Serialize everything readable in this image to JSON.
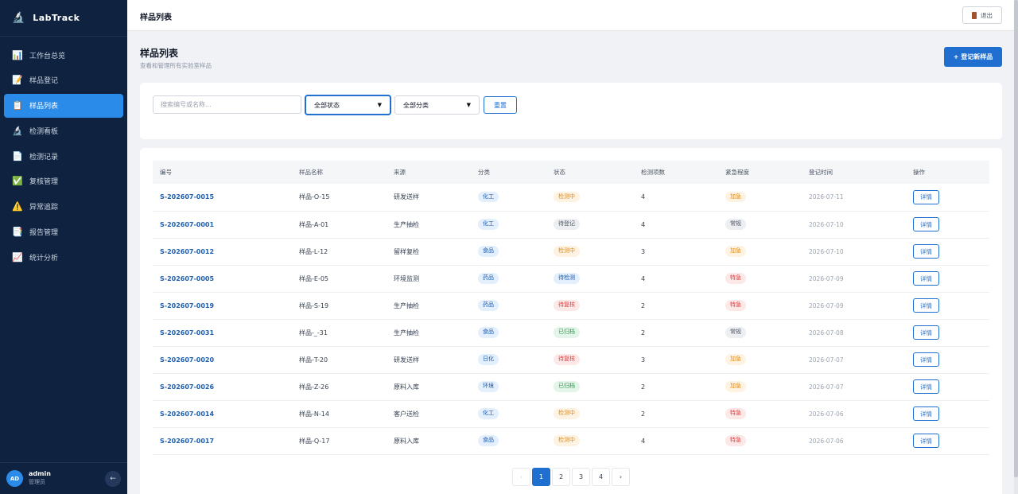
{
  "brand": {
    "logo": "🔬",
    "name": "LabTrack"
  },
  "sidebar": {
    "items": [
      {
        "icon": "📊",
        "label": "工作台总览"
      },
      {
        "icon": "📝",
        "label": "样品登记"
      },
      {
        "icon": "📋",
        "label": "样品列表",
        "active": true
      },
      {
        "icon": "🔬",
        "label": "检测看板"
      },
      {
        "icon": "📄",
        "label": "检测记录"
      },
      {
        "icon": "✅",
        "label": "复核管理"
      },
      {
        "icon": "⚠️",
        "label": "异常追踪"
      },
      {
        "icon": "📑",
        "label": "报告管理"
      },
      {
        "icon": "📈",
        "label": "统计分析"
      }
    ]
  },
  "user": {
    "initials": "AD",
    "name": "admin",
    "role": "管理员",
    "collapse_icon": "←"
  },
  "topbar": {
    "title": "样品列表",
    "logout_label": "退出"
  },
  "page": {
    "title": "样品列表",
    "subtitle": "查看和管理所有实验室样品",
    "add_button": "+ 登记新样品"
  },
  "filters": {
    "search_placeholder": "搜索编号或名称...",
    "status": "全部状态",
    "category": "全部分类",
    "reset": "重置"
  },
  "table": {
    "headers": [
      "编号",
      "样品名称",
      "来源",
      "分类",
      "状态",
      "检测项数",
      "紧急程度",
      "登记时间",
      "操作"
    ],
    "rows": [
      {
        "code": "S-202607-0015",
        "name": "样品-O-15",
        "source": "研发送样",
        "category": "化工",
        "status": "检测中",
        "status_color": "orange",
        "items": "4",
        "urgency": "加急",
        "urgency_color": "orange",
        "date": "2026-07-11",
        "action": "详情"
      },
      {
        "code": "S-202607-0001",
        "name": "样品-A-01",
        "source": "生产抽检",
        "category": "化工",
        "status": "待登记",
        "status_color": "gray",
        "items": "4",
        "urgency": "常规",
        "urgency_color": "gray",
        "date": "2026-07-10",
        "action": "详情"
      },
      {
        "code": "S-202607-0012",
        "name": "样品-L-12",
        "source": "留样复检",
        "category": "食品",
        "status": "检测中",
        "status_color": "orange",
        "items": "3",
        "urgency": "加急",
        "urgency_color": "orange",
        "date": "2026-07-10",
        "action": "详情"
      },
      {
        "code": "S-202607-0005",
        "name": "样品-E-05",
        "source": "环境监测",
        "category": "药品",
        "status": "待检测",
        "status_color": "blue",
        "items": "4",
        "urgency": "特急",
        "urgency_color": "red",
        "date": "2026-07-09",
        "action": "详情"
      },
      {
        "code": "S-202607-0019",
        "name": "样品-S-19",
        "source": "生产抽检",
        "category": "药品",
        "status": "待复核",
        "status_color": "red",
        "items": "2",
        "urgency": "特急",
        "urgency_color": "red",
        "date": "2026-07-09",
        "action": "详情"
      },
      {
        "code": "S-202607-0031",
        "name": "样品-_-31",
        "source": "生产抽检",
        "category": "食品",
        "status": "已归档",
        "status_color": "green",
        "items": "2",
        "urgency": "常规",
        "urgency_color": "gray",
        "date": "2026-07-08",
        "action": "详情"
      },
      {
        "code": "S-202607-0020",
        "name": "样品-T-20",
        "source": "研发送样",
        "category": "日化",
        "status": "待复核",
        "status_color": "red",
        "items": "3",
        "urgency": "加急",
        "urgency_color": "orange",
        "date": "2026-07-07",
        "action": "详情"
      },
      {
        "code": "S-202607-0026",
        "name": "样品-Z-26",
        "source": "原料入库",
        "category": "环境",
        "status": "已归档",
        "status_color": "green",
        "items": "2",
        "urgency": "加急",
        "urgency_color": "orange",
        "date": "2026-07-07",
        "action": "详情"
      },
      {
        "code": "S-202607-0014",
        "name": "样品-N-14",
        "source": "客户送检",
        "category": "化工",
        "status": "检测中",
        "status_color": "orange",
        "items": "2",
        "urgency": "特急",
        "urgency_color": "red",
        "date": "2026-07-06",
        "action": "详情"
      },
      {
        "code": "S-202607-0017",
        "name": "样品-Q-17",
        "source": "原料入库",
        "category": "食品",
        "status": "检测中",
        "status_color": "orange",
        "items": "4",
        "urgency": "特急",
        "urgency_color": "red",
        "date": "2026-07-06",
        "action": "详情"
      }
    ]
  },
  "pagination": {
    "prev": "‹",
    "pages": [
      "1",
      "2",
      "3",
      "4"
    ],
    "current": "1",
    "next": "›"
  }
}
